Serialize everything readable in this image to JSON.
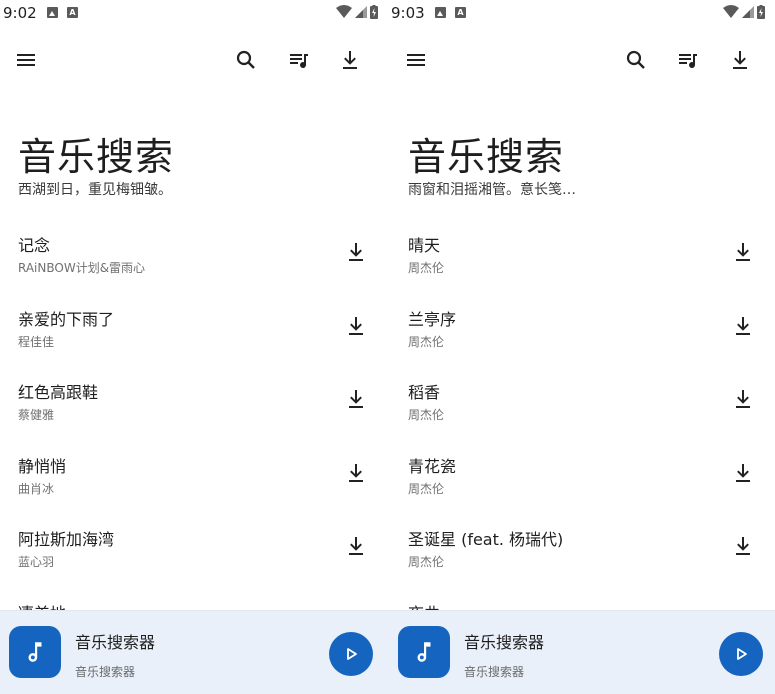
{
  "screens": [
    {
      "status": {
        "time": "9:02"
      },
      "title": "音乐搜索",
      "subtitle": "西湖到日，重见梅钿皱。",
      "songs": [
        {
          "title": "记念",
          "artist": "RAiNBOW计划&雷雨心"
        },
        {
          "title": "亲爱的下雨了",
          "artist": "程佳佳"
        },
        {
          "title": "红色高跟鞋",
          "artist": "蔡健雅"
        },
        {
          "title": "静悄悄",
          "artist": "曲肖冰"
        },
        {
          "title": "阿拉斯加海湾",
          "artist": "蓝心羽"
        },
        {
          "title": "凄美地",
          "artist": ""
        }
      ],
      "player": {
        "title": "音乐搜索器",
        "subtitle": "音乐搜索器"
      }
    },
    {
      "status": {
        "time": "9:03"
      },
      "title": "音乐搜索",
      "subtitle": "雨窗和泪摇湘管。意长笺…",
      "songs": [
        {
          "title": "晴天",
          "artist": "周杰伦"
        },
        {
          "title": "兰亭序",
          "artist": "周杰伦"
        },
        {
          "title": "稻香",
          "artist": "周杰伦"
        },
        {
          "title": "青花瓷",
          "artist": "周杰伦"
        },
        {
          "title": "圣诞星 (feat. 杨瑞代)",
          "artist": "周杰伦"
        },
        {
          "title": "夜曲",
          "artist": ""
        }
      ],
      "player": {
        "title": "音乐搜索器",
        "subtitle": "音乐搜索器"
      }
    }
  ],
  "icons": {
    "menu": "menu-icon",
    "search": "search-icon",
    "queue": "queue-music-icon",
    "download": "download-icon",
    "note": "music-note-icon",
    "play": "play-icon"
  },
  "colors": {
    "accent": "#1565c0",
    "player_bg": "#eaf0fa"
  }
}
